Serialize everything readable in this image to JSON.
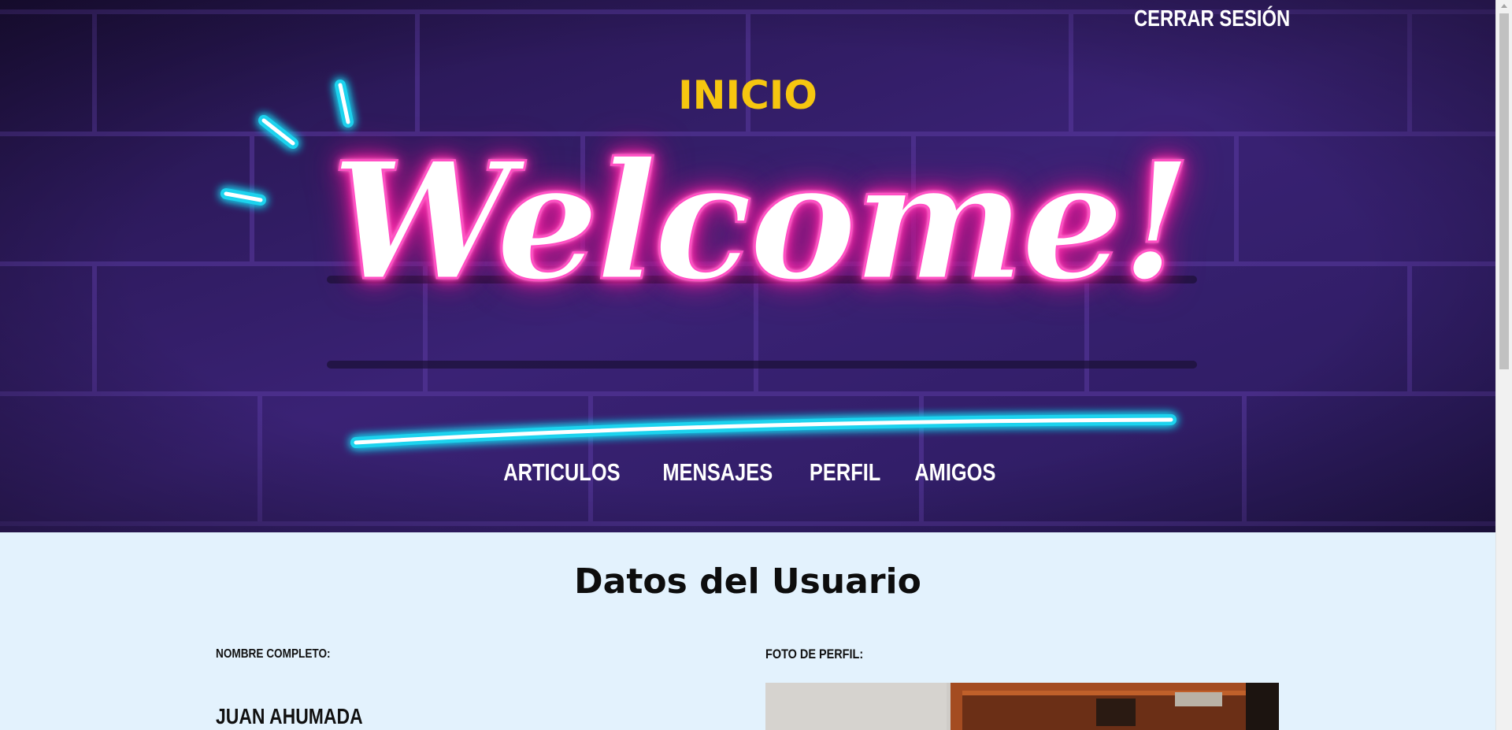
{
  "header": {
    "logout_label": "CERRAR SESIÓN",
    "title": "INICIO",
    "banner_text": "Welcome!"
  },
  "nav": {
    "items": [
      {
        "label": "ARTICULOS"
      },
      {
        "label": "MENSAJES"
      },
      {
        "label": "PERFIL"
      },
      {
        "label": "AMIGOS"
      }
    ]
  },
  "user_section": {
    "title": "Datos del Usuario",
    "name_label": "NOMBRE COMPLETO:",
    "name_value": "JUAN AHUMADA",
    "photo_label": "FOTO DE PERFIL:"
  },
  "colors": {
    "hero_background": "#2c1b5e",
    "title_yellow": "#f6c610",
    "neon_pink": "#ff2da8",
    "neon_cyan": "#1fd3ee",
    "content_background": "#e3f2fd"
  }
}
